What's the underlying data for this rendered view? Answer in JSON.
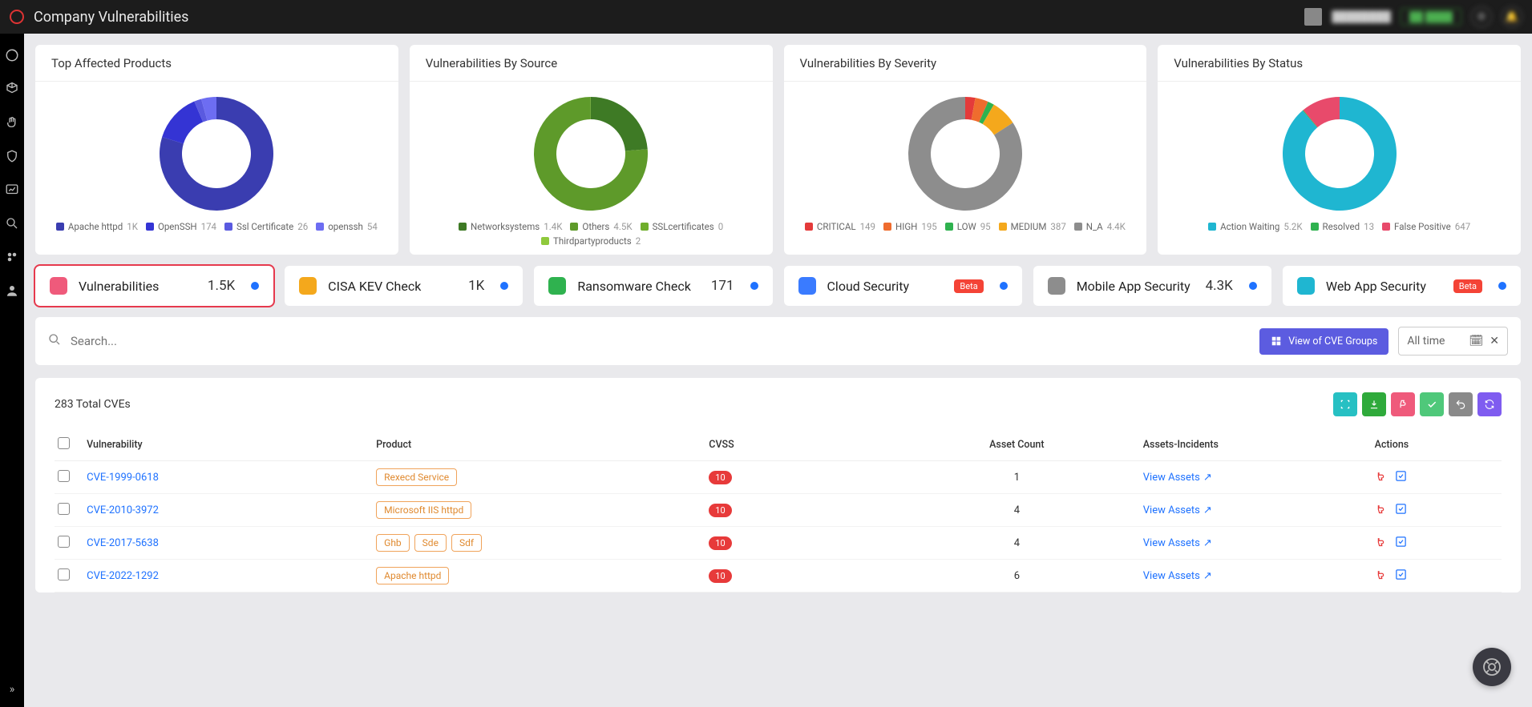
{
  "header": {
    "title": "Company Vulnerabilities"
  },
  "chart_data": [
    {
      "type": "pie",
      "title": "Top Affected Products",
      "series": [
        {
          "name": "Apache httpd",
          "value": 1000,
          "color": "#3a3db0"
        },
        {
          "name": "OpenSSH",
          "value": 174,
          "color": "#3434d4"
        },
        {
          "name": "Ssl Certificate",
          "value": 26,
          "color": "#5a5ae0"
        },
        {
          "name": "openssh",
          "value": 54,
          "color": "#6d6df2"
        }
      ],
      "legend": [
        {
          "name": "Apache httpd",
          "value": "1K"
        },
        {
          "name": "OpenSSH",
          "value": "174"
        },
        {
          "name": "Ssl Certificate",
          "value": "26"
        },
        {
          "name": "openssh",
          "value": "54"
        }
      ]
    },
    {
      "type": "pie",
      "title": "Vulnerabilities By Source",
      "series": [
        {
          "name": "Networksystems",
          "value": 1400,
          "color": "#3e7a25"
        },
        {
          "name": "Others",
          "value": 4500,
          "color": "#5e9a2a"
        },
        {
          "name": "SSLcertificates",
          "value": 0,
          "color": "#6fae2c"
        },
        {
          "name": "Thirdpartyproducts",
          "value": 2,
          "color": "#8fc93c"
        }
      ],
      "legend": [
        {
          "name": "Networksystems",
          "value": "1.4K"
        },
        {
          "name": "Others",
          "value": "4.5K"
        },
        {
          "name": "SSLcertificates",
          "value": "0"
        },
        {
          "name": "Thirdpartyproducts",
          "value": "2"
        }
      ]
    },
    {
      "type": "pie",
      "title": "Vulnerabilities By Severity",
      "series": [
        {
          "name": "CRITICAL",
          "value": 149,
          "color": "#e43a3a"
        },
        {
          "name": "HIGH",
          "value": 195,
          "color": "#ef6c2e"
        },
        {
          "name": "LOW",
          "value": 95,
          "color": "#2fb24f"
        },
        {
          "name": "MEDIUM",
          "value": 387,
          "color": "#f4a81c"
        },
        {
          "name": "N_A",
          "value": 4400,
          "color": "#8d8d8d"
        }
      ],
      "legend": [
        {
          "name": "CRITICAL",
          "value": "149"
        },
        {
          "name": "HIGH",
          "value": "195"
        },
        {
          "name": "LOW",
          "value": "95"
        },
        {
          "name": "MEDIUM",
          "value": "387"
        },
        {
          "name": "N_A",
          "value": "4.4K"
        }
      ]
    },
    {
      "type": "pie",
      "title": "Vulnerabilities By Status",
      "series": [
        {
          "name": "Action Waiting",
          "value": 5200,
          "color": "#1fb6d1"
        },
        {
          "name": "Resolved",
          "value": 13,
          "color": "#2fb24f"
        },
        {
          "name": "False Positive",
          "value": 647,
          "color": "#e84a6b"
        }
      ],
      "legend": [
        {
          "name": "Action Waiting",
          "value": "5.2K"
        },
        {
          "name": "Resolved",
          "value": "13"
        },
        {
          "name": "False Positive",
          "value": "647"
        }
      ]
    }
  ],
  "tabs": [
    {
      "label": "Vulnerabilities",
      "value": "1.5K",
      "color": "#ef5a7b",
      "active": true
    },
    {
      "label": "CISA KEV Check",
      "value": "1K",
      "color": "#f4a81c"
    },
    {
      "label": "Ransomware Check",
      "value": "171",
      "color": "#2fb24f"
    },
    {
      "label": "Cloud Security",
      "beta": "Beta",
      "color": "#3a7bff"
    },
    {
      "label": "Mobile App Security",
      "value": "4.3K",
      "color": "#8d8d8d"
    },
    {
      "label": "Web App Security",
      "beta": "Beta",
      "color": "#1fb6d1"
    }
  ],
  "search": {
    "placeholder": "Search...",
    "cve_button": "View of CVE Groups",
    "date": "All time"
  },
  "panel": {
    "total": "283 Total CVEs",
    "columns": [
      "Vulnerability",
      "Product",
      "CVSS",
      "Asset Count",
      "Assets-Incidents",
      "Actions"
    ],
    "view_assets": "View Assets",
    "rows": [
      {
        "cve": "CVE-1999-0618",
        "products": [
          "Rexecd Service"
        ],
        "cvss": "10",
        "asset_count": "1"
      },
      {
        "cve": "CVE-2010-3972",
        "products": [
          "Microsoft IIS httpd"
        ],
        "cvss": "10",
        "asset_count": "4"
      },
      {
        "cve": "CVE-2017-5638",
        "products": [
          "Ghb",
          "Sde",
          "Sdf"
        ],
        "cvss": "10",
        "asset_count": "4"
      },
      {
        "cve": "CVE-2022-1292",
        "products": [
          "Apache httpd"
        ],
        "cvss": "10",
        "asset_count": "6"
      }
    ]
  }
}
